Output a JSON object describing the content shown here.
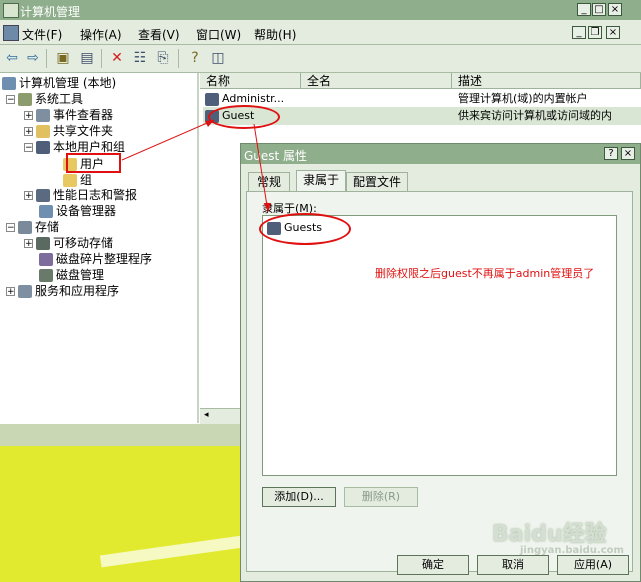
{
  "window": {
    "title": "计算机管理",
    "minimize": "_",
    "restore": "□",
    "close": "×"
  },
  "menubar": {
    "items": [
      "文件(F)",
      "操作(A)",
      "查看(V)",
      "窗口(W)",
      "帮助(H)"
    ],
    "child_min": "_",
    "child_restore": "❐",
    "child_close": "×"
  },
  "tree": {
    "items": [
      {
        "label": "计算机管理 (本地)",
        "icon": "computer-icon"
      },
      {
        "label": "系统工具",
        "icon": "tools-icon"
      },
      {
        "label": "事件查看器",
        "icon": "event-viewer-icon"
      },
      {
        "label": "共享文件夹",
        "icon": "shared-folder-icon"
      },
      {
        "label": "本地用户和组",
        "icon": "users-groups-icon"
      },
      {
        "label": "用户",
        "icon": "folder-icon"
      },
      {
        "label": "组",
        "icon": "folder-icon"
      },
      {
        "label": "性能日志和警报",
        "icon": "performance-icon"
      },
      {
        "label": "设备管理器",
        "icon": "device-manager-icon"
      },
      {
        "label": "存储",
        "icon": "storage-icon"
      },
      {
        "label": "可移动存储",
        "icon": "removable-storage-icon"
      },
      {
        "label": "磁盘碎片整理程序",
        "icon": "defrag-icon"
      },
      {
        "label": "磁盘管理",
        "icon": "disk-management-icon"
      },
      {
        "label": "服务和应用程序",
        "icon": "services-icon"
      }
    ]
  },
  "list": {
    "columns": [
      "名称",
      "全名",
      "描述"
    ],
    "rows": [
      {
        "name": "Administr...",
        "fullname": "",
        "desc": "管理计算机(域)的内置帐户"
      },
      {
        "name": "Guest",
        "fullname": "",
        "desc": "供来宾访问计算机或访问域的内"
      }
    ]
  },
  "dialog": {
    "title": "Guest 属性",
    "help": "?",
    "close": "×",
    "tabs": [
      "常规",
      "隶属于",
      "配置文件"
    ],
    "member_of_label": "隶属于(M):",
    "members": [
      "Guests"
    ],
    "add_button": "添加(D)...",
    "remove_button": "删除(R)",
    "ok_button": "确定",
    "cancel_button": "取消",
    "apply_button": "应用(A)"
  },
  "annotation": {
    "note": "删除权限之后guest不再属于admin管理员了"
  },
  "watermark": {
    "brand": "Baidu经验",
    "url": "jingyan.baidu.com"
  }
}
